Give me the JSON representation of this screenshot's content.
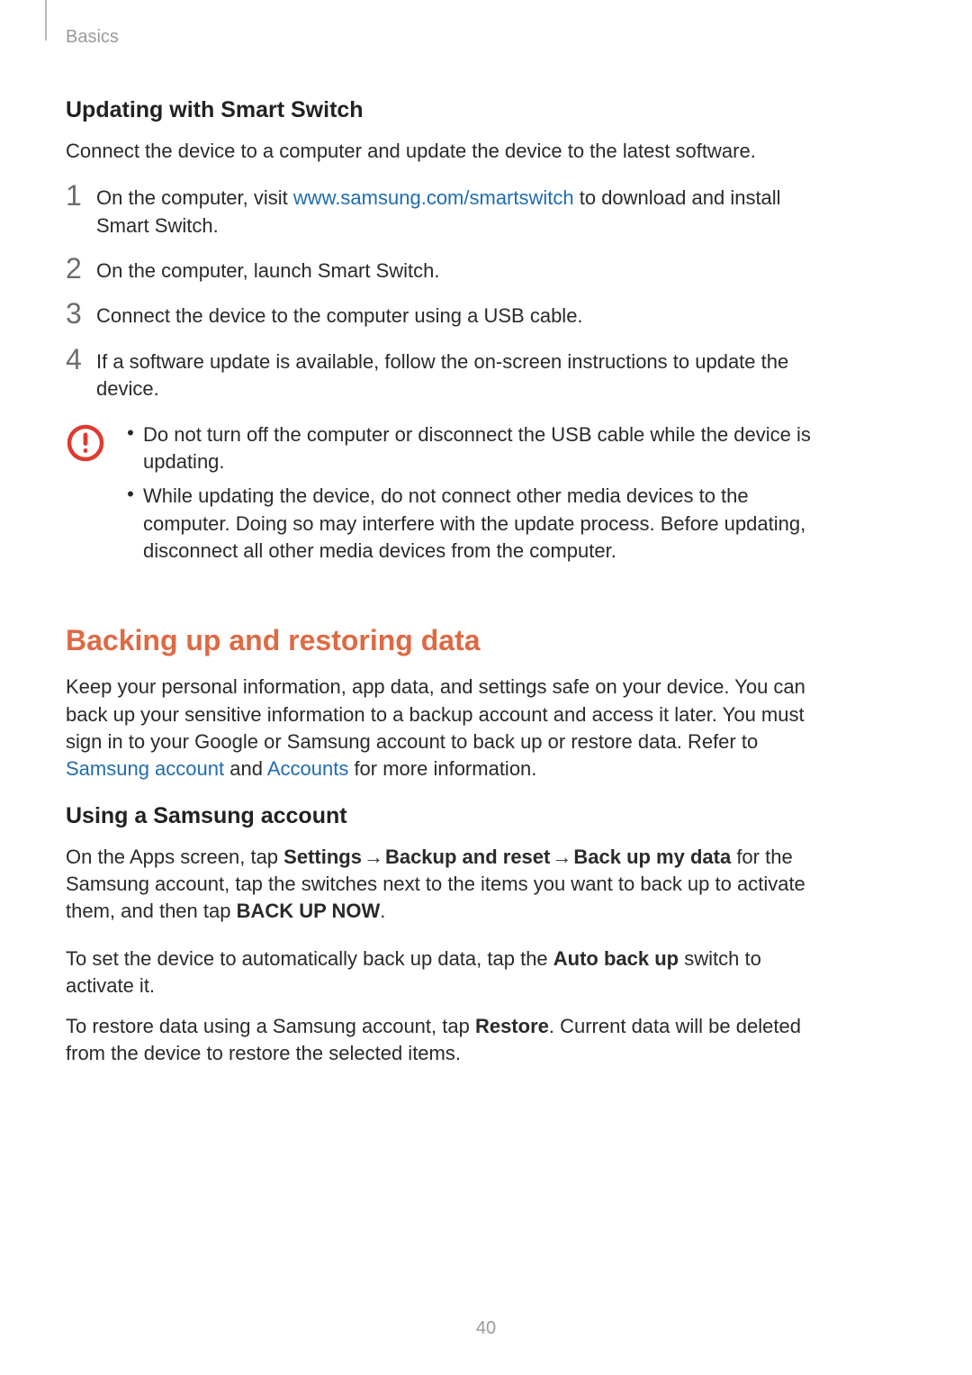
{
  "header": {
    "breadcrumb": "Basics"
  },
  "section_a": {
    "heading": "Updating with Smart Switch",
    "intro": "Connect the device to a computer and update the device to the latest software.",
    "steps": {
      "s1": {
        "num": "1",
        "pre": "On the computer, visit ",
        "link": "www.samsung.com/smartswitch",
        "post": " to download and install Smart Switch."
      },
      "s2": {
        "num": "2",
        "text": "On the computer, launch Smart Switch."
      },
      "s3": {
        "num": "3",
        "text": "Connect the device to the computer using a USB cable."
      },
      "s4": {
        "num": "4",
        "text": "If a software update is available, follow the on-screen instructions to update the device."
      }
    },
    "caution": {
      "b1": "Do not turn off the computer or disconnect the USB cable while the device is updating.",
      "b2": "While updating the device, do not connect other media devices to the computer. Doing so may interfere with the update process. Before updating, disconnect all other media devices from the computer."
    }
  },
  "section_b": {
    "heading": "Backing up and restoring data",
    "intro": {
      "pre": "Keep your personal information, app data, and settings safe on your device. You can back up your sensitive information to a backup account and access it later. You must sign in to your Google or Samsung account to back up or restore data. Refer to ",
      "link1": "Samsung account",
      "mid": " and ",
      "link2": "Accounts",
      "post": " for more information."
    },
    "sub_heading": "Using a Samsung account",
    "p1": {
      "t0": "On the Apps screen, tap ",
      "b1": "Settings",
      "arrow1": " → ",
      "b2": "Backup and reset",
      "arrow2": " → ",
      "b3": "Back up my data",
      "t1": " for the Samsung account, tap the switches next to the items you want to back up to activate them, and then tap ",
      "b4": "BACK UP NOW",
      "t2": "."
    },
    "p2": {
      "t0": "To set the device to automatically back up data, tap the ",
      "b1": "Auto back up",
      "t1": " switch to activate it."
    },
    "p3": {
      "t0": "To restore data using a Samsung account, tap ",
      "b1": "Restore",
      "t1": ". Current data will be deleted from the device to restore the selected items."
    }
  },
  "page_number": "40",
  "glyphs": {
    "bullet": "•"
  }
}
